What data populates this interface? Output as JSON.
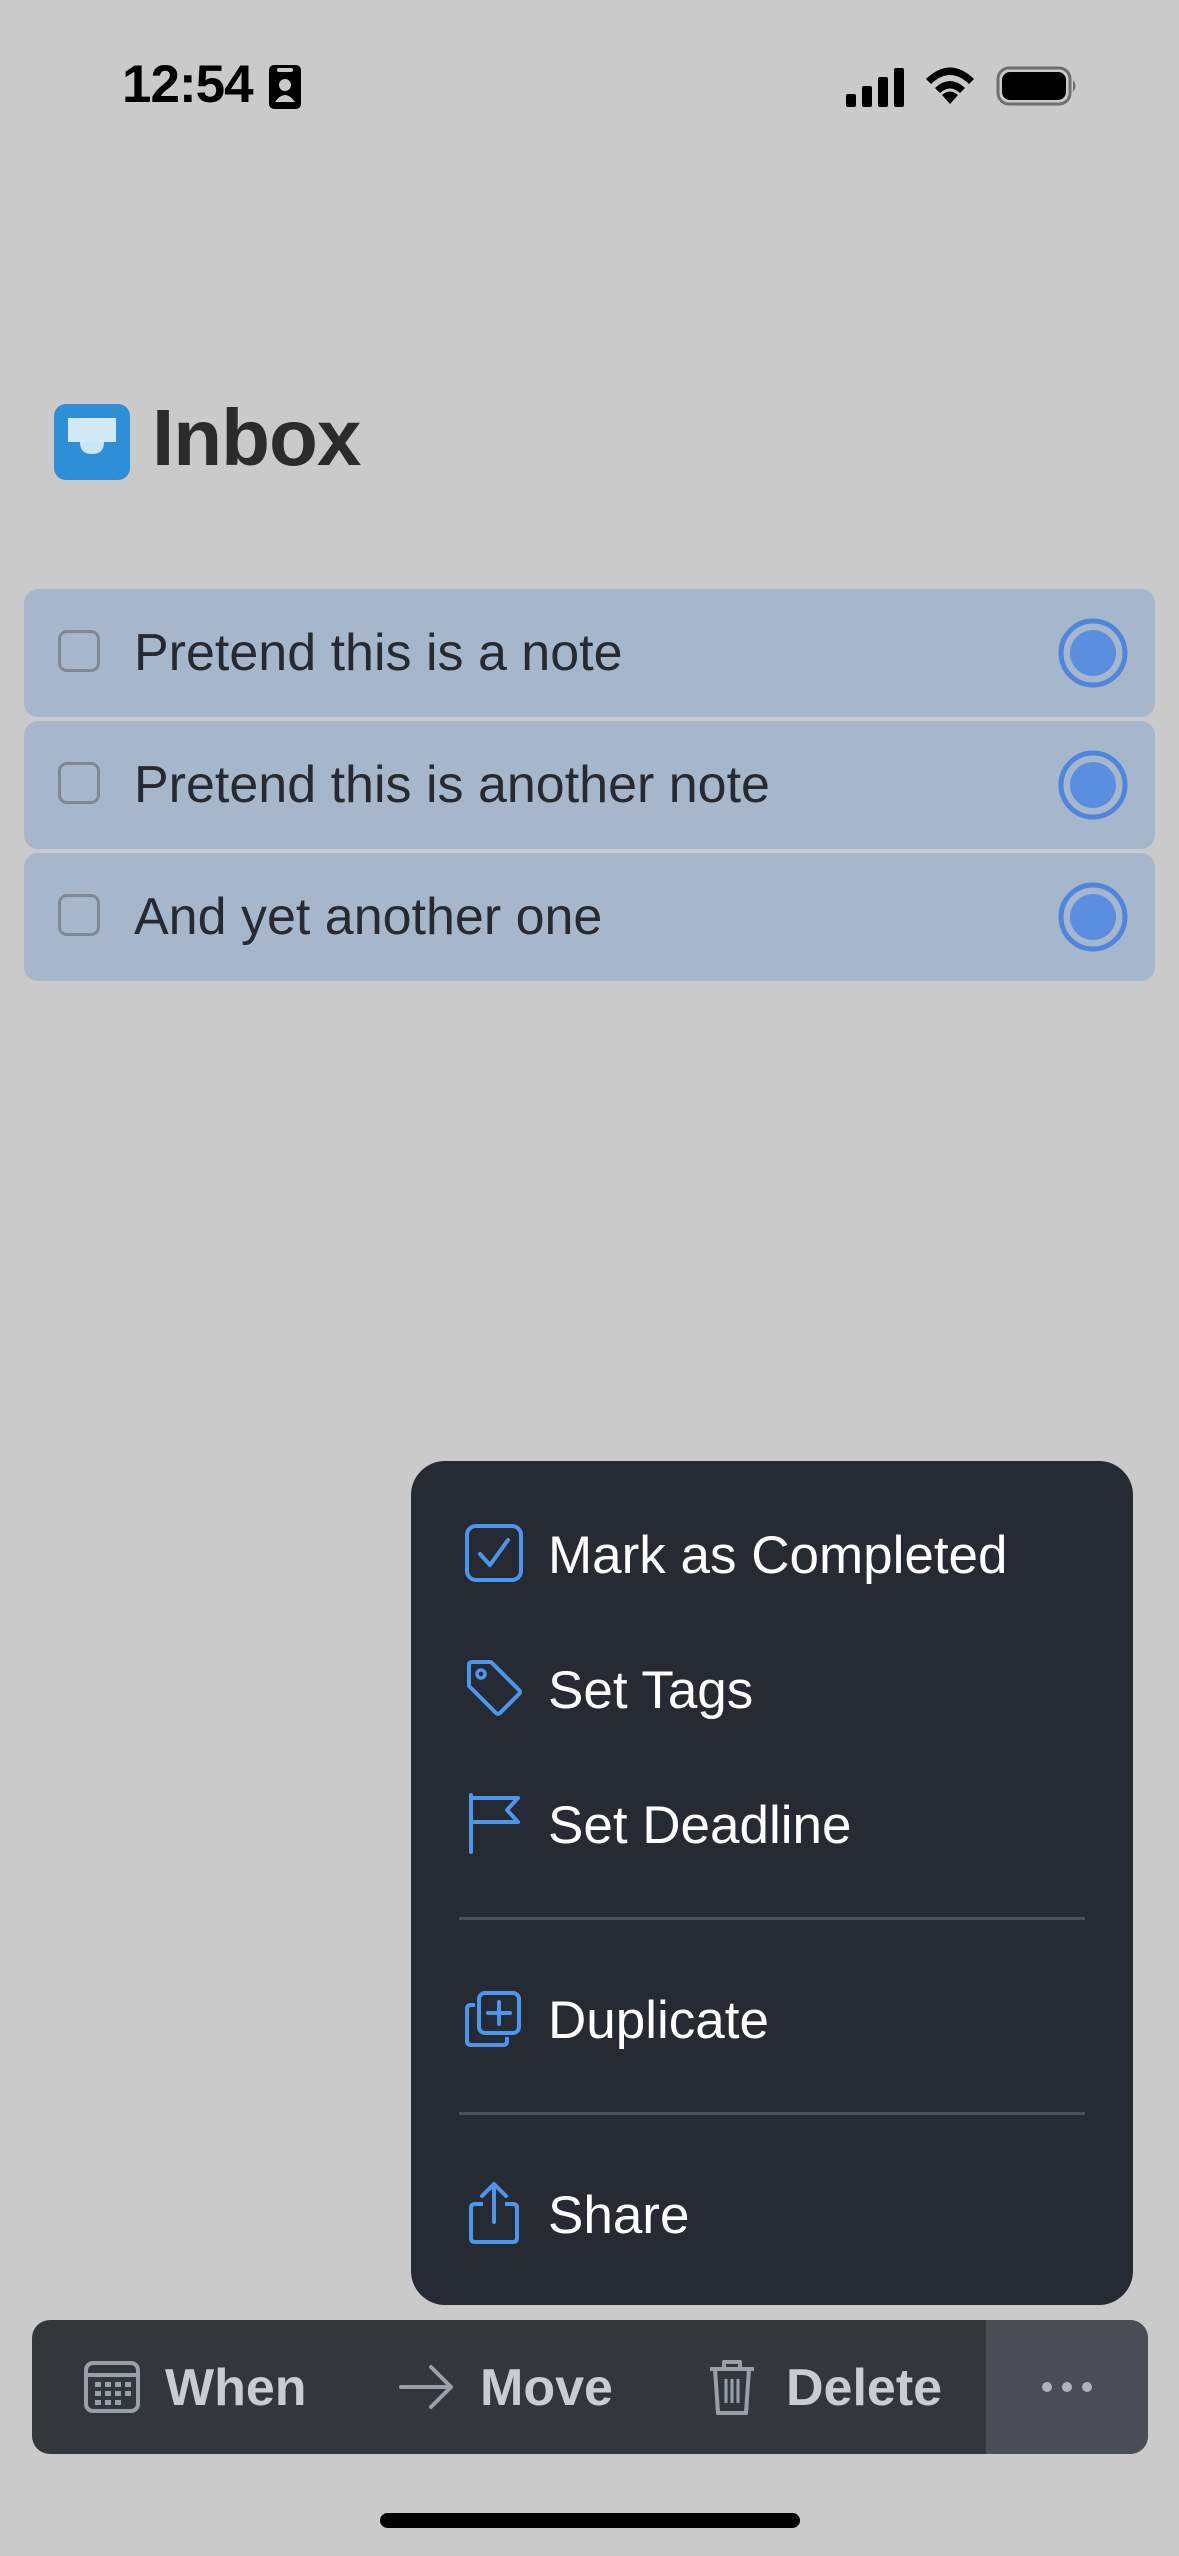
{
  "status_bar": {
    "time": "12:54",
    "icons": [
      "id-card-icon",
      "signal-icon",
      "wifi-icon",
      "battery-icon"
    ]
  },
  "header": {
    "icon": "inbox-tray-icon",
    "title": "Inbox"
  },
  "tasks": [
    {
      "label": "Pretend this is a note",
      "selected": true
    },
    {
      "label": "Pretend this is another note",
      "selected": true
    },
    {
      "label": "And yet another one",
      "selected": true
    }
  ],
  "context_menu": {
    "items": [
      {
        "label": "Mark as Completed",
        "icon": "checkbox-checked-icon"
      },
      {
        "label": "Set Tags",
        "icon": "tag-icon"
      },
      {
        "label": "Set Deadline",
        "icon": "flag-icon"
      },
      {
        "label": "Duplicate",
        "icon": "duplicate-icon"
      },
      {
        "label": "Share",
        "icon": "share-icon"
      }
    ]
  },
  "toolbar": {
    "when_label": "When",
    "move_label": "Move",
    "delete_label": "Delete",
    "more_icon": "more-dots-icon"
  },
  "colors": {
    "background": "#cacaca",
    "task_selected_bg": "#a7b7cb",
    "accent_blue": "#4a90e2",
    "menu_bg": "#262b33",
    "toolbar_bg": "#33373c"
  }
}
